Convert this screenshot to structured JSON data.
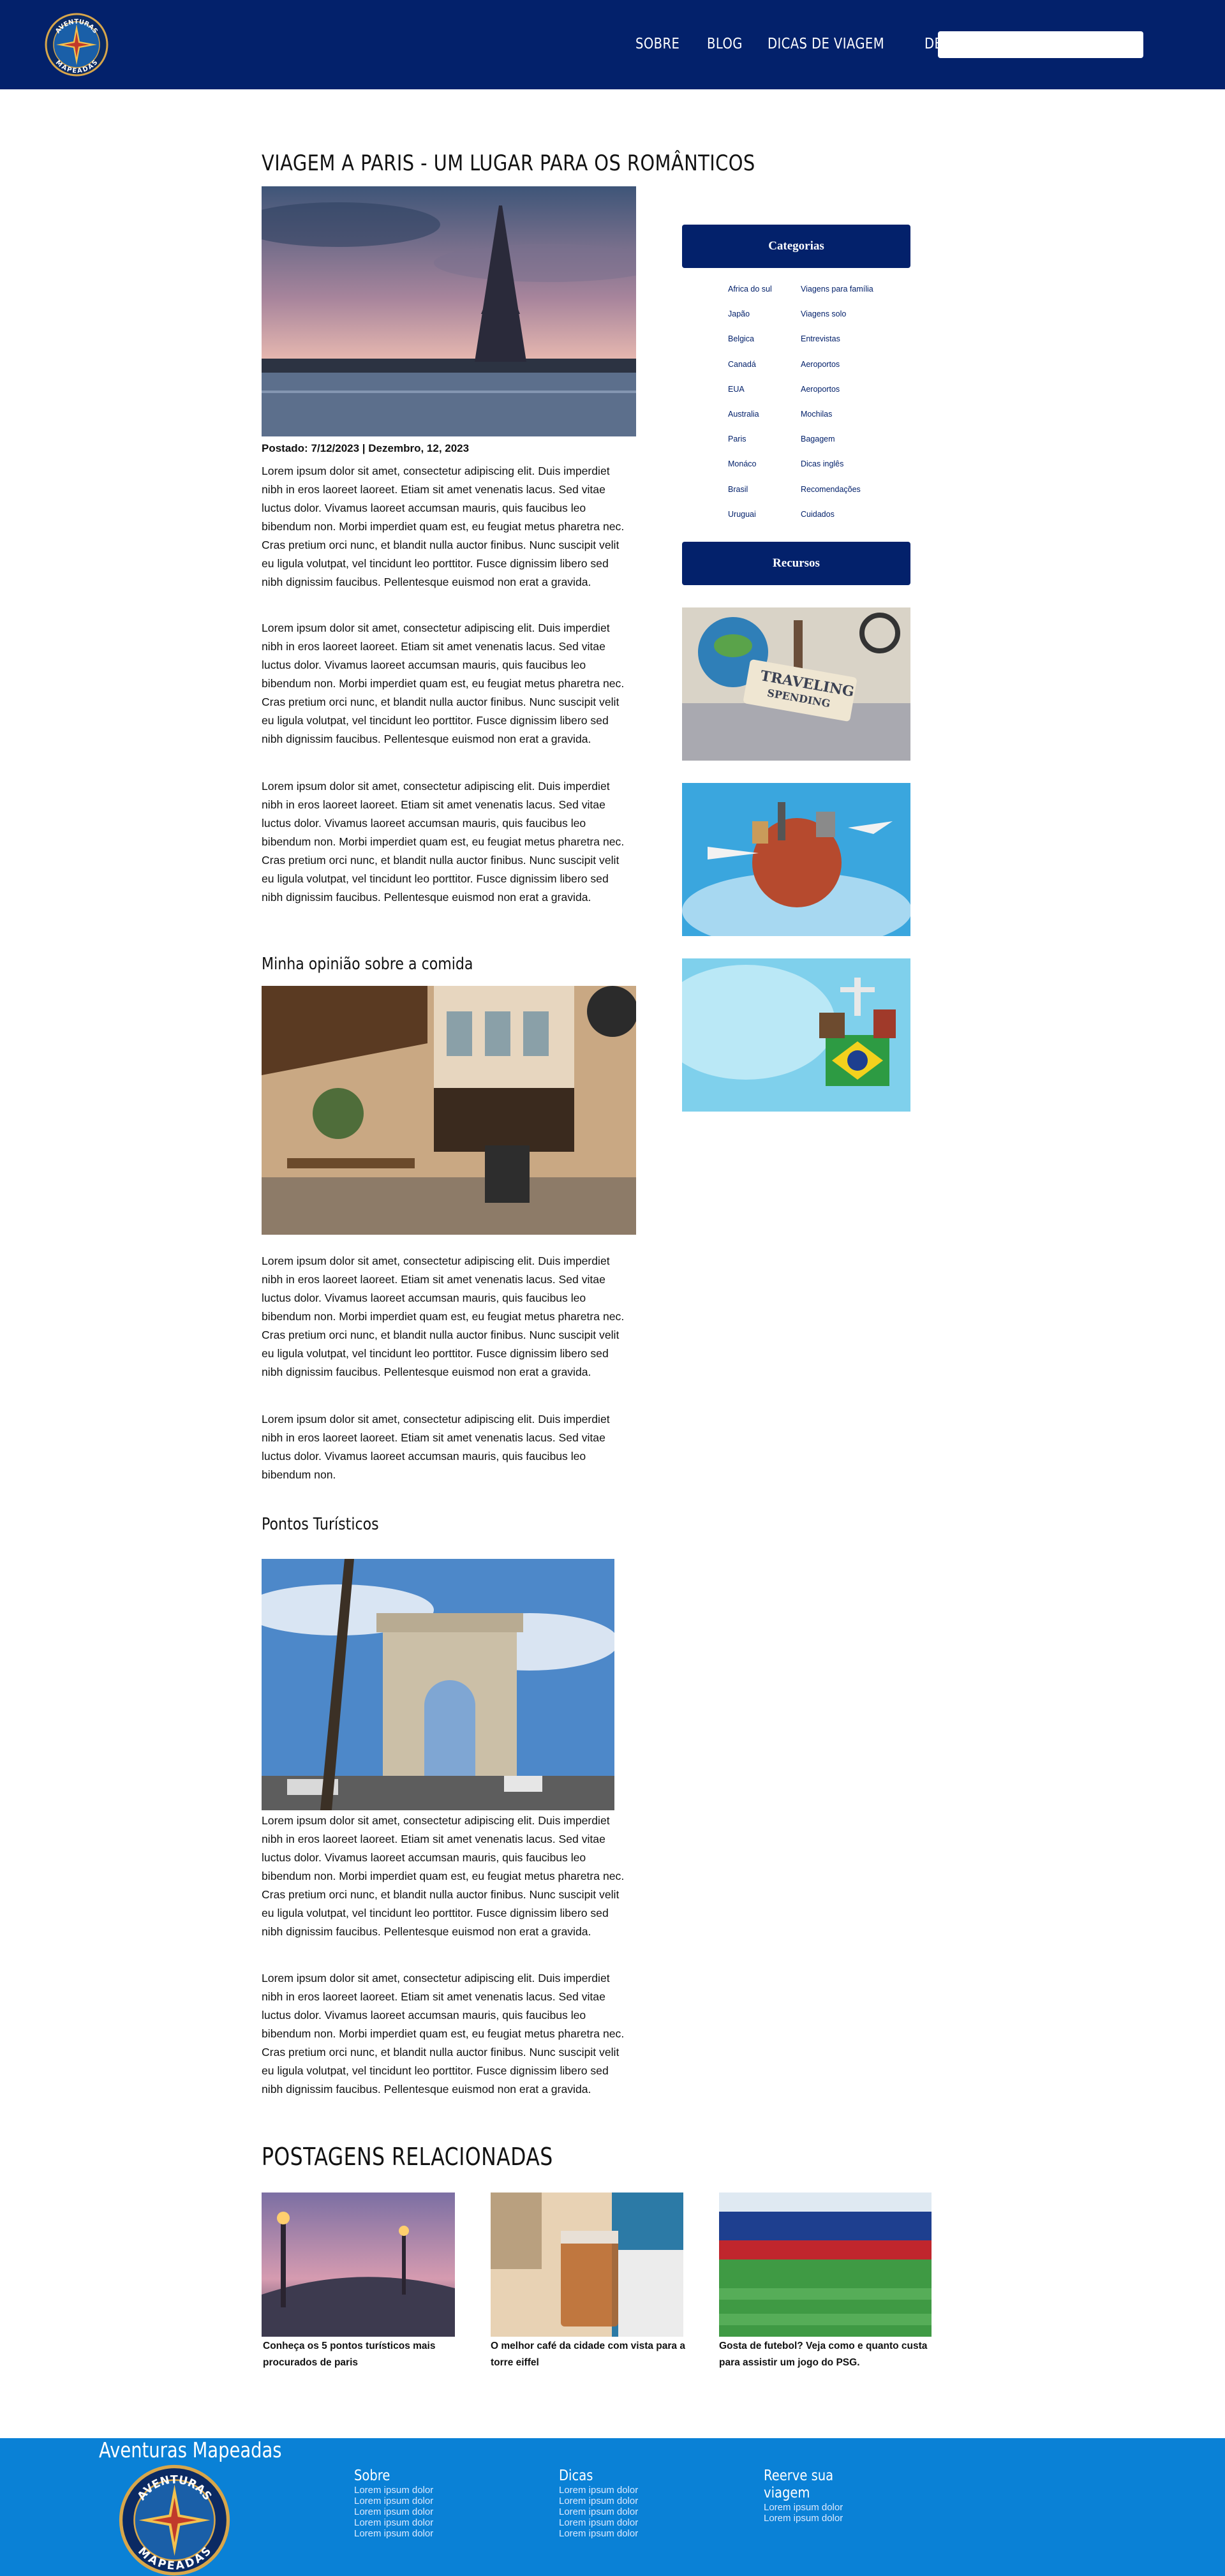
{
  "brand": {
    "logo_text_top": "AVENTURAS",
    "logo_text_bottom": "MAPEADAS"
  },
  "nav": {
    "items": [
      "SOBRE",
      "BLOG",
      "DICAS DE VIAGEM",
      "DESTINOS"
    ],
    "search_value": ""
  },
  "article": {
    "title": "VIAGEM A PARIS - UM LUGAR PARA OS ROMÂNTICOS",
    "posted": "Postado: 7/12/2023 | Dezembro, 12, 2023",
    "paragraphs_intro": [
      "Lorem ipsum dolor sit amet, consectetur adipiscing elit. Duis imperdiet nibh in eros laoreet laoreet. Etiam sit amet venenatis lacus. Sed vitae luctus dolor. Vivamus laoreet accumsan mauris, quis faucibus leo bibendum non. Morbi imperdiet quam est, eu feugiat metus pharetra nec. Cras pretium orci nunc, et blandit nulla auctor finibus. Nunc suscipit velit eu ligula volutpat, vel tincidunt leo porttitor. Fusce dignissim libero sed nibh dignissim faucibus. Pellentesque euismod non erat a gravida.",
      "Lorem ipsum dolor sit amet, consectetur adipiscing elit. Duis imperdiet nibh in eros laoreet laoreet. Etiam sit amet venenatis lacus. Sed vitae luctus dolor. Vivamus laoreet accumsan mauris, quis faucibus leo bibendum non. Morbi imperdiet quam est, eu feugiat metus pharetra nec. Cras pretium orci nunc, et blandit nulla auctor finibus. Nunc suscipit velit eu ligula volutpat, vel tincidunt leo porttitor. Fusce dignissim libero sed nibh dignissim faucibus. Pellentesque euismod non erat a gravida.",
      "Lorem ipsum dolor sit amet, consectetur adipiscing elit. Duis imperdiet nibh in eros laoreet laoreet. Etiam sit amet venenatis lacus. Sed vitae luctus dolor. Vivamus laoreet accumsan mauris, quis faucibus leo bibendum non. Morbi imperdiet quam est, eu feugiat metus pharetra nec. Cras pretium orci nunc, et blandit nulla auctor finibus. Nunc suscipit velit eu ligula volutpat, vel tincidunt leo porttitor. Fusce dignissim libero sed nibh dignissim faucibus. Pellentesque euismod non erat a gravida."
    ],
    "food_heading": "Minha opinião sobre a comida",
    "paragraphs_food": [
      "Lorem ipsum dolor sit amet, consectetur adipiscing elit. Duis imperdiet nibh in eros laoreet laoreet. Etiam sit amet venenatis lacus. Sed vitae luctus dolor. Vivamus laoreet accumsan mauris, quis faucibus leo bibendum non. Morbi imperdiet quam est, eu feugiat metus pharetra nec. Cras pretium orci nunc, et blandit nulla auctor finibus. Nunc suscipit velit eu ligula volutpat, vel tincidunt leo porttitor. Fusce dignissim libero sed nibh dignissim faucibus. Pellentesque euismod non erat a gravida.",
      "Lorem ipsum dolor sit amet, consectetur adipiscing elit. Duis imperdiet nibh in eros laoreet laoreet. Etiam sit amet venenatis lacus. Sed vitae luctus dolor. Vivamus laoreet accumsan mauris, quis faucibus leo bibendum non."
    ],
    "tourism_heading": "Pontos Turísticos",
    "paragraphs_tourism": [
      "Lorem ipsum dolor sit amet, consectetur adipiscing elit. Duis imperdiet nibh in eros laoreet laoreet. Etiam sit amet venenatis lacus. Sed vitae luctus dolor. Vivamus laoreet accumsan mauris, quis faucibus leo bibendum non. Morbi imperdiet quam est, eu feugiat metus pharetra nec. Cras pretium orci nunc, et blandit nulla auctor finibus. Nunc suscipit velit eu ligula volutpat, vel tincidunt leo porttitor. Fusce dignissim libero sed nibh dignissim faucibus. Pellentesque euismod non erat a gravida.",
      "Lorem ipsum dolor sit amet, consectetur adipiscing elit. Duis imperdiet nibh in eros laoreet laoreet. Etiam sit amet venenatis lacus. Sed vitae luctus dolor. Vivamus laoreet accumsan mauris, quis faucibus leo bibendum non. Morbi imperdiet quam est, eu feugiat metus pharetra nec. Cras pretium orci nunc, et blandit nulla auctor finibus. Nunc suscipit velit eu ligula volutpat, vel tincidunt leo porttitor. Fusce dignissim libero sed nibh dignissim faucibus. Pellentesque euismod non erat a gravida."
    ]
  },
  "sidebar": {
    "categories_title": "Categorias",
    "categories_left": [
      "Africa do sul",
      "Japão",
      "Belgica",
      "Canadá",
      "EUA",
      "Australia",
      "Paris",
      "Monáco",
      "Brasil",
      "Uruguai"
    ],
    "categories_right": [
      "Viagens para família",
      "Viagens solo",
      "Entrevistas",
      "Aeroportos",
      "Aeroportos",
      "Mochilas",
      "Bagagem",
      "Dicas inglês",
      "Recomendações",
      "Cuidados"
    ],
    "resources_title": "Recursos",
    "resource1_sign_top": "TRAVELING",
    "resource1_sign_bottom": "SPENDING"
  },
  "related": {
    "title": "POSTAGENS RELACIONADAS",
    "items": [
      "Conheça os 5 pontos turísticos mais procurados de paris",
      "O melhor café da cidade com vista para a torre eiffel",
      "Gosta de futebol? Veja como e quanto custa para assistir um jogo do PSG."
    ]
  },
  "footer": {
    "brand": "Aventuras Mapeadas",
    "columns": [
      {
        "title": "Sobre",
        "links": [
          "Lorem ipsum dolor",
          "Lorem ipsum dolor",
          "Lorem ipsum dolor",
          "Lorem ipsum dolor",
          "Lorem ipsum dolor"
        ]
      },
      {
        "title": "Dicas",
        "links": [
          "Lorem ipsum dolor",
          "Lorem ipsum dolor",
          "Lorem ipsum dolor",
          "Lorem ipsum dolor",
          "Lorem ipsum dolor"
        ]
      },
      {
        "title": "Reerve sua viagem",
        "links": [
          "Lorem ipsum dolor",
          "Lorem ipsum dolor"
        ]
      }
    ]
  },
  "colors": {
    "navy": "#03216b",
    "footer_blue": "#0a81d6"
  },
  "icons": [
    "compass-logo-icon"
  ]
}
